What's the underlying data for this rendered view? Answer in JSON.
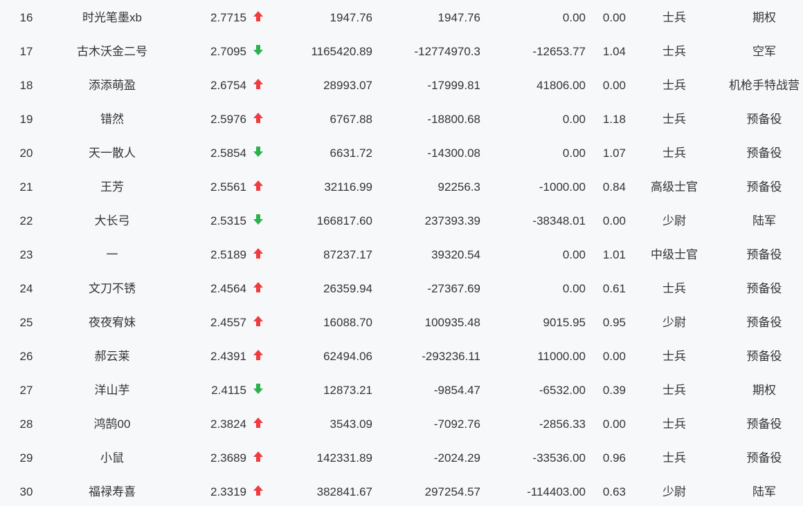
{
  "colors": {
    "up": "#f03c3c",
    "down": "#2bb24c",
    "text": "#333333",
    "background": "#f7f8fa"
  },
  "rows": [
    {
      "rank": "16",
      "name": "时光笔墨xb",
      "score": "2.7715",
      "trend": "up",
      "a": "1947.76",
      "b": "1947.76",
      "c": "0.00",
      "d": "0.00",
      "level": "士兵",
      "team": "期权"
    },
    {
      "rank": "17",
      "name": "古木沃金二号",
      "score": "2.7095",
      "trend": "down",
      "a": "1165420.89",
      "b": "-12774970.3",
      "c": "-12653.77",
      "d": "1.04",
      "level": "士兵",
      "team": "空军"
    },
    {
      "rank": "18",
      "name": "添添萌盈",
      "score": "2.6754",
      "trend": "up",
      "a": "28993.07",
      "b": "-17999.81",
      "c": "41806.00",
      "d": "0.00",
      "level": "士兵",
      "team": "机枪手特战营"
    },
    {
      "rank": "19",
      "name": "错然",
      "score": "2.5976",
      "trend": "up",
      "a": "6767.88",
      "b": "-18800.68",
      "c": "0.00",
      "d": "1.18",
      "level": "士兵",
      "team": "预备役"
    },
    {
      "rank": "20",
      "name": "天一散人",
      "score": "2.5854",
      "trend": "down",
      "a": "6631.72",
      "b": "-14300.08",
      "c": "0.00",
      "d": "1.07",
      "level": "士兵",
      "team": "预备役"
    },
    {
      "rank": "21",
      "name": "王芳",
      "score": "2.5561",
      "trend": "up",
      "a": "32116.99",
      "b": "92256.3",
      "c": "-1000.00",
      "d": "0.84",
      "level": "高级士官",
      "team": "预备役"
    },
    {
      "rank": "22",
      "name": "大长弓",
      "score": "2.5315",
      "trend": "down",
      "a": "166817.60",
      "b": "237393.39",
      "c": "-38348.01",
      "d": "0.00",
      "level": "少尉",
      "team": "陆军"
    },
    {
      "rank": "23",
      "name": "一",
      "score": "2.5189",
      "trend": "up",
      "a": "87237.17",
      "b": "39320.54",
      "c": "0.00",
      "d": "1.01",
      "level": "中级士官",
      "team": "预备役"
    },
    {
      "rank": "24",
      "name": "文刀不锈",
      "score": "2.4564",
      "trend": "up",
      "a": "26359.94",
      "b": "-27367.69",
      "c": "0.00",
      "d": "0.61",
      "level": "士兵",
      "team": "预备役"
    },
    {
      "rank": "25",
      "name": "夜夜宥妹",
      "score": "2.4557",
      "trend": "up",
      "a": "16088.70",
      "b": "100935.48",
      "c": "9015.95",
      "d": "0.95",
      "level": "少尉",
      "team": "预备役"
    },
    {
      "rank": "26",
      "name": "郝云莱",
      "score": "2.4391",
      "trend": "up",
      "a": "62494.06",
      "b": "-293236.11",
      "c": "11000.00",
      "d": "0.00",
      "level": "士兵",
      "team": "预备役"
    },
    {
      "rank": "27",
      "name": "洋山芋",
      "score": "2.4115",
      "trend": "down",
      "a": "12873.21",
      "b": "-9854.47",
      "c": "-6532.00",
      "d": "0.39",
      "level": "士兵",
      "team": "期权"
    },
    {
      "rank": "28",
      "name": "鸿鹄00",
      "score": "2.3824",
      "trend": "up",
      "a": "3543.09",
      "b": "-7092.76",
      "c": "-2856.33",
      "d": "0.00",
      "level": "士兵",
      "team": "预备役"
    },
    {
      "rank": "29",
      "name": "小鼠",
      "score": "2.3689",
      "trend": "up",
      "a": "142331.89",
      "b": "-2024.29",
      "c": "-33536.00",
      "d": "0.96",
      "level": "士兵",
      "team": "预备役"
    },
    {
      "rank": "30",
      "name": "福禄寿喜",
      "score": "2.3319",
      "trend": "up",
      "a": "382841.67",
      "b": "297254.57",
      "c": "-114403.00",
      "d": "0.63",
      "level": "少尉",
      "team": "陆军"
    }
  ]
}
